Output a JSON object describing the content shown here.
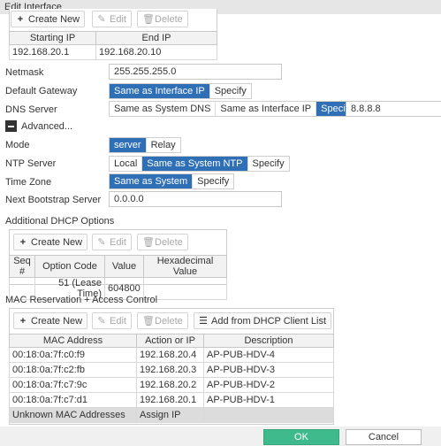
{
  "title": "Edit Interface",
  "ip_range": {
    "create_new": "Create New",
    "edit": "Edit",
    "delete": "Delete",
    "headers": [
      "Starting IP",
      "End IP"
    ],
    "rows": [
      [
        "192.168.20.1",
        "192.168.20.10"
      ]
    ]
  },
  "form": {
    "netmask_label": "Netmask",
    "netmask_value": "255.255.255.0",
    "gateway_label": "Default Gateway",
    "gateway_options": [
      "Same as Interface IP",
      "Specify"
    ],
    "gateway_selected": 0,
    "dns_label": "DNS Server",
    "dns_options": [
      "Same as System DNS",
      "Same as Interface IP",
      "Specify"
    ],
    "dns_selected": 2,
    "dns_value": "8.8.8.8",
    "advanced_label": "Advanced...",
    "mode_label": "Mode",
    "mode_options": [
      "server",
      "Relay"
    ],
    "mode_selected": 0,
    "ntp_label": "NTP Server",
    "ntp_options": [
      "Local",
      "Same as System NTP",
      "Specify"
    ],
    "ntp_selected": 1,
    "tz_label": "Time Zone",
    "tz_options": [
      "Same as System",
      "Specify"
    ],
    "tz_selected": 0,
    "bootstrap_label": "Next Bootstrap Server",
    "bootstrap_value": "0.0.0.0"
  },
  "dhcp_options": {
    "section_title": "Additional DHCP Options",
    "create_new": "Create New",
    "edit": "Edit",
    "delete": "Delete",
    "headers": [
      "Seq #",
      "Option Code",
      "Value",
      "Hexadecimal Value"
    ],
    "rows": [
      [
        "",
        "51 (Lease Time)",
        "604800",
        ""
      ]
    ]
  },
  "mac": {
    "section_title": "MAC Reservation + Access Control",
    "create_new": "Create New",
    "edit": "Edit",
    "delete": "Delete",
    "add_from_dhcp": "Add from DHCP Client List",
    "headers": [
      "MAC Address",
      "Action or IP",
      "Description"
    ],
    "rows": [
      [
        "00:18:0a:7f:c0:f9",
        "192.168.20.4",
        "AP-PUB-HDV-4"
      ],
      [
        "00:18:0a:7f:c2:fb",
        "192.168.20.3",
        "AP-PUB-HDV-3"
      ],
      [
        "00:18:0a:7f:c7:9c",
        "192.168.20.2",
        "AP-PUB-HDV-2"
      ],
      [
        "00:18:0a:7f:c7:d1",
        "192.168.20.1",
        "AP-PUB-HDV-1"
      ]
    ],
    "unknown_row": [
      "Unknown MAC Addresses",
      "Assign IP",
      ""
    ]
  },
  "footer": {
    "ok": "OK",
    "cancel": "Cancel"
  },
  "colors": {
    "accent": "#2f6fb6",
    "ok": "#3fba8c"
  }
}
